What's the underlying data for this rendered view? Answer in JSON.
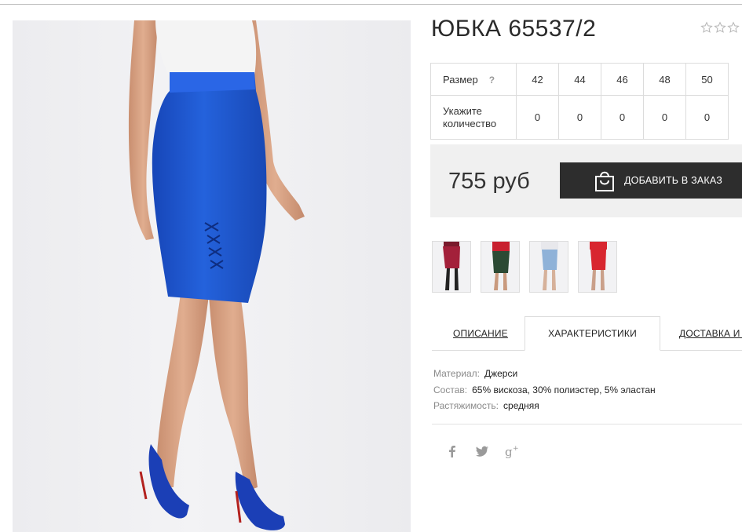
{
  "product": {
    "title": "ЮБКА 65537/2",
    "rating_max": 5,
    "rating_value": 0
  },
  "sizes_table": {
    "size_label": "Размер",
    "help_mark": "?",
    "qty_label_line1": "Укажите",
    "qty_label_line2": "количество",
    "sizes": [
      "42",
      "44",
      "46",
      "48",
      "50"
    ],
    "quantities": [
      "0",
      "0",
      "0",
      "0",
      "0"
    ]
  },
  "purchase": {
    "price": "755 руб",
    "order_button_label": "ДОБАВИТЬ В ЗАКАЗ"
  },
  "thumbnails": [
    {
      "color": "#a3203a",
      "legs": "#222222",
      "top": "#7a1a2c"
    },
    {
      "color": "#2c4a34",
      "legs": "#c99a7e",
      "top": "#c8202f"
    },
    {
      "color": "#8fb2d8",
      "legs": "#d6b19a",
      "top": "#e8e8ec"
    },
    {
      "color": "#d8262f",
      "legs": "#caa08a",
      "top": "#d8262f"
    }
  ],
  "tabs": {
    "description": "ОПИСАНИЕ",
    "characteristics": "ХАРАКТЕРИСТИКИ",
    "delivery": "ДОСТАВКА И ОПЛАТА"
  },
  "specs": [
    {
      "key": "Материал:",
      "value": "Джерси"
    },
    {
      "key": "Состав:",
      "value": "65% вискоза, 30% полиэстер, 5% эластан"
    },
    {
      "key": "Растяжимость:",
      "value": "средняя"
    }
  ],
  "social": [
    "facebook-icon",
    "twitter-icon",
    "google-plus-icon"
  ],
  "colors": {
    "skirt": "#1e56d0",
    "button": "#2d2d2d",
    "price_box": "#f0f0f0"
  }
}
